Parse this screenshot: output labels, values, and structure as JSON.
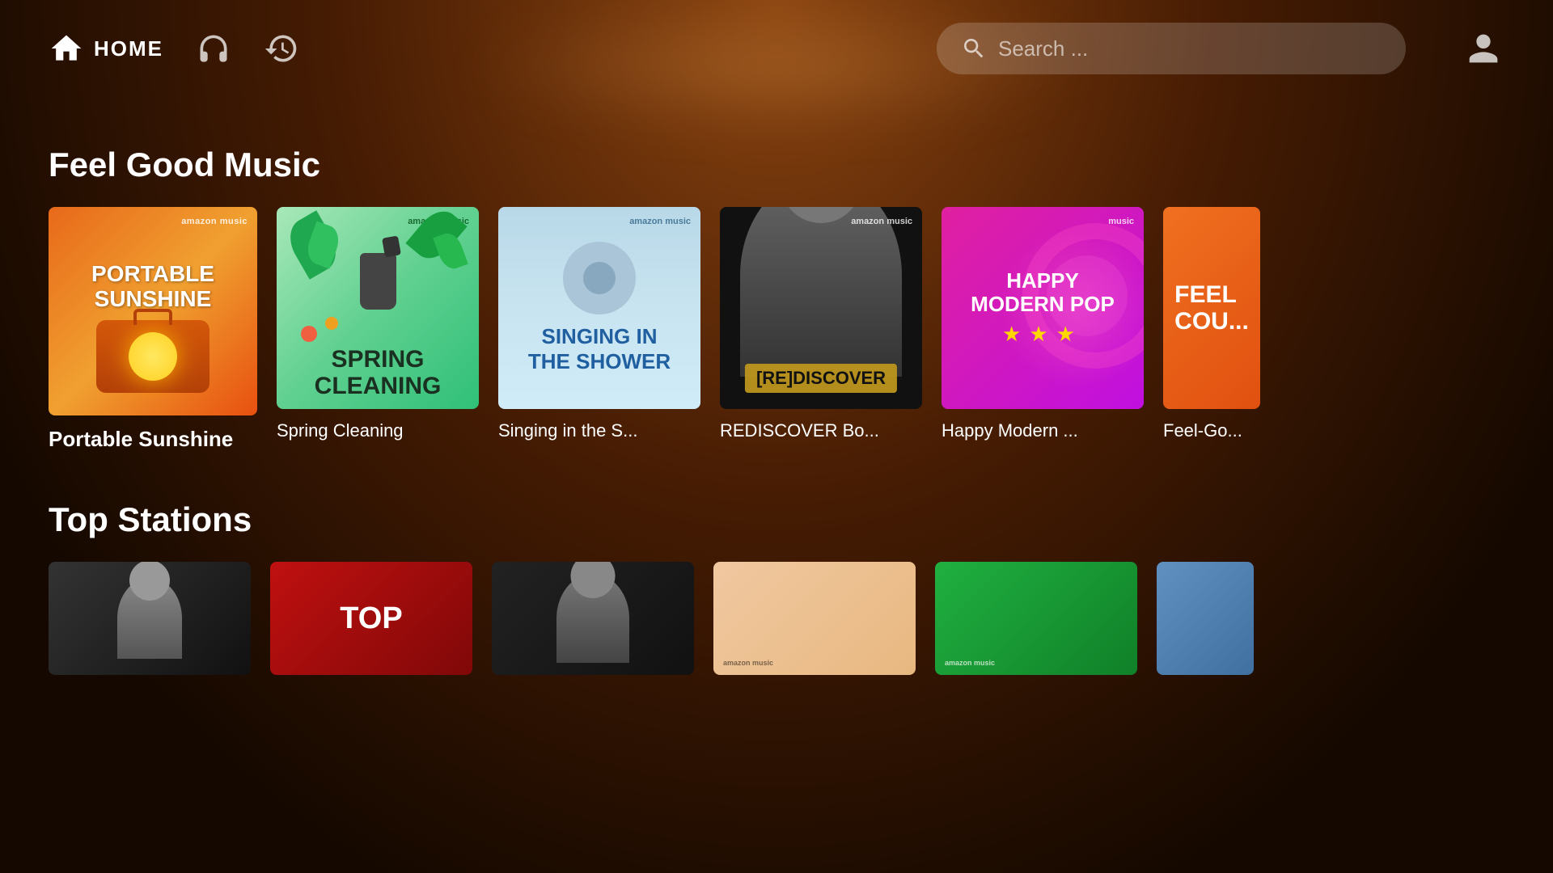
{
  "header": {
    "home_label": "HOME",
    "search_placeholder": "Search ...",
    "nav_items": [
      "home",
      "headphones",
      "history"
    ]
  },
  "feel_good_section": {
    "title": "Feel Good Music",
    "cards": [
      {
        "id": "portable-sunshine",
        "label": "Portable Sunshine",
        "badge": "amazon music",
        "art_type": "portable"
      },
      {
        "id": "spring-cleaning",
        "label": "Spring Cleaning",
        "badge": "amazon music",
        "art_type": "spring"
      },
      {
        "id": "singing-shower",
        "label": "Singing in the S...",
        "badge": "amazon music",
        "art_type": "shower"
      },
      {
        "id": "rediscover",
        "label": "REDISCOVER Bo...",
        "badge": "amazon music",
        "art_type": "rediscover"
      },
      {
        "id": "happy-modern-pop",
        "label": "Happy Modern ...",
        "badge": "music",
        "art_type": "happy"
      },
      {
        "id": "feel-good-country",
        "label": "Feel-Go...",
        "badge": "",
        "art_type": "feelgood"
      }
    ]
  },
  "top_stations_section": {
    "title": "Top Stations",
    "cards": [
      {
        "id": "station-dark",
        "art_type": "dark",
        "label": ""
      },
      {
        "id": "station-top",
        "art_type": "red",
        "top_text": "TOP",
        "label": ""
      },
      {
        "id": "station-dark2",
        "art_type": "dark2",
        "label": ""
      },
      {
        "id": "station-pastel",
        "art_type": "pastel",
        "badge": "amazon music",
        "label": ""
      },
      {
        "id": "station-green",
        "art_type": "green",
        "badge": "amazon music",
        "label": ""
      },
      {
        "id": "station-blue",
        "art_type": "blue",
        "label": ""
      }
    ]
  }
}
